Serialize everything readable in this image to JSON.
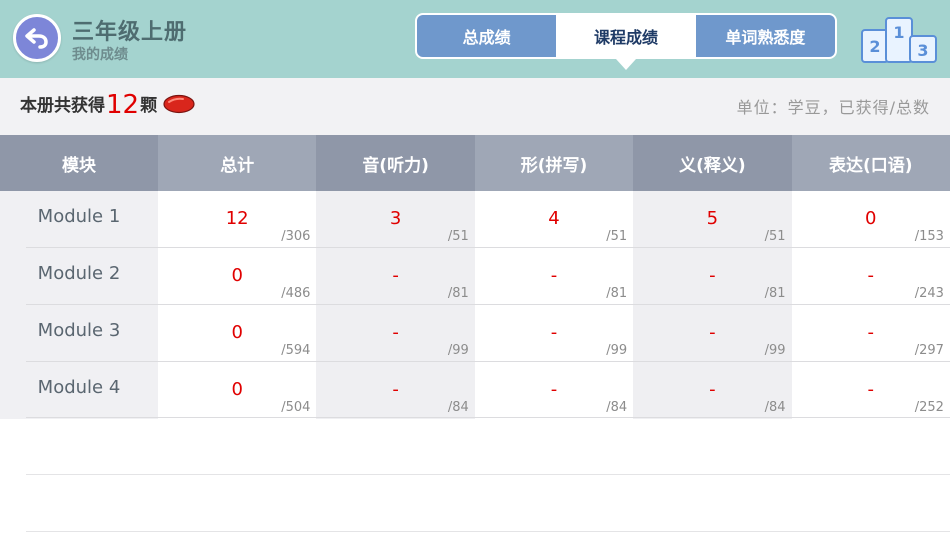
{
  "header": {
    "title": "三年级上册",
    "subtitle": "我的成绩",
    "tabs": [
      {
        "label": "总成绩",
        "active": false
      },
      {
        "label": "课程成绩",
        "active": true
      },
      {
        "label": "单词熟悉度",
        "active": false
      }
    ],
    "rank_icon_numbers": [
      "2",
      "1",
      "3"
    ]
  },
  "summary": {
    "prefix": "本册共获得",
    "count": "12",
    "suffix": "颗",
    "unit_note": "单位：学豆，已获得/总数"
  },
  "table": {
    "columns": [
      "模块",
      "总计",
      "音(听力)",
      "形(拼写)",
      "义(释义)",
      "表达(口语)"
    ],
    "rows": [
      {
        "name": "Module 1",
        "cells": [
          [
            "12",
            "/306"
          ],
          [
            "3",
            "/51"
          ],
          [
            "4",
            "/51"
          ],
          [
            "5",
            "/51"
          ],
          [
            "0",
            "/153"
          ]
        ]
      },
      {
        "name": "Module 2",
        "cells": [
          [
            "0",
            "/486"
          ],
          [
            "-",
            "/81"
          ],
          [
            "-",
            "/81"
          ],
          [
            "-",
            "/81"
          ],
          [
            "-",
            "/243"
          ]
        ]
      },
      {
        "name": "Module 3",
        "cells": [
          [
            "0",
            "/594"
          ],
          [
            "-",
            "/99"
          ],
          [
            "-",
            "/99"
          ],
          [
            "-",
            "/99"
          ],
          [
            "-",
            "/297"
          ]
        ]
      },
      {
        "name": "Module 4",
        "cells": [
          [
            "0",
            "/504"
          ],
          [
            "-",
            "/84"
          ],
          [
            "-",
            "/84"
          ],
          [
            "-",
            "/84"
          ],
          [
            "-",
            "/252"
          ]
        ]
      }
    ]
  },
  "colors": {
    "header_bg": "#a4d3cf",
    "tab_inactive": "#6f98cc",
    "back_button": "#7d86d8",
    "value_red": "#e00000",
    "table_header": "#8f97a8"
  }
}
